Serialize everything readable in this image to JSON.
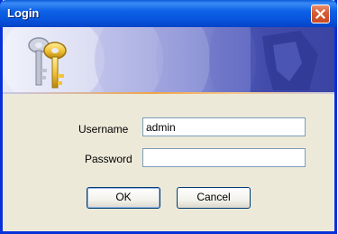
{
  "window": {
    "title": "Login"
  },
  "form": {
    "username_label": "Username",
    "username_value": "admin",
    "password_label": "Password",
    "password_value": ""
  },
  "buttons": {
    "ok_label": "OK",
    "cancel_label": "Cancel"
  },
  "icons": {
    "banner": "keys-icon",
    "close": "close-icon"
  },
  "colors": {
    "titlebar": "#0855dd",
    "frame": "#0831d9",
    "dialog_background": "#ece9d8",
    "close_button": "#d65b33"
  }
}
